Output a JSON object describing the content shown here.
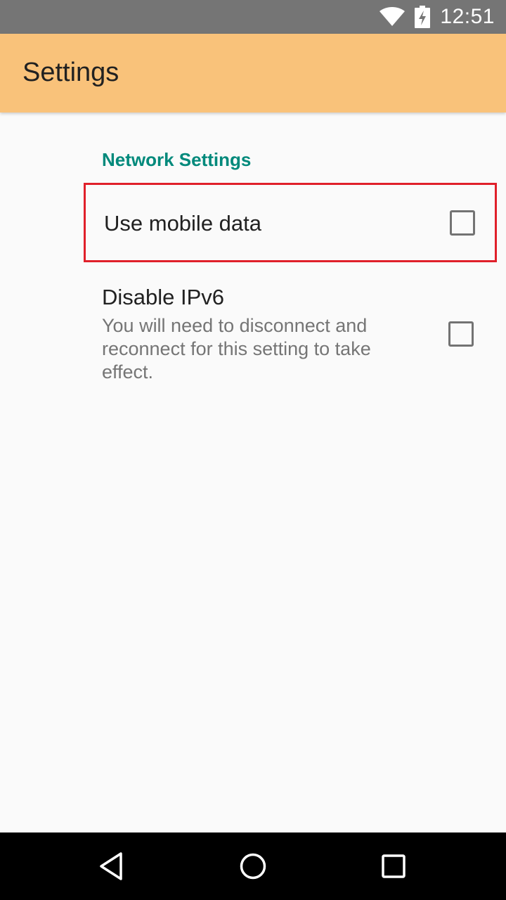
{
  "status_bar": {
    "time": "12:51",
    "icons": [
      "wifi-icon",
      "battery-charging-icon"
    ],
    "background": "#757575"
  },
  "app_bar": {
    "title": "Settings",
    "background": "#f9c27a"
  },
  "preferences": {
    "category_title": "Network Settings",
    "category_color": "#00897b",
    "items": [
      {
        "title": "Use mobile data",
        "summary": "",
        "checked": false,
        "highlighted": true
      },
      {
        "title": "Disable IPv6",
        "summary": "You will need to disconnect and reconnect for this setting to take effect.",
        "checked": false,
        "highlighted": false
      }
    ]
  },
  "nav_bar": {
    "buttons": [
      "back-icon",
      "home-icon",
      "recents-icon"
    ]
  },
  "colors": {
    "highlight_border": "#e0202a",
    "title_text": "#212121",
    "summary_text": "#757575",
    "checkbox_border": "#737373"
  }
}
